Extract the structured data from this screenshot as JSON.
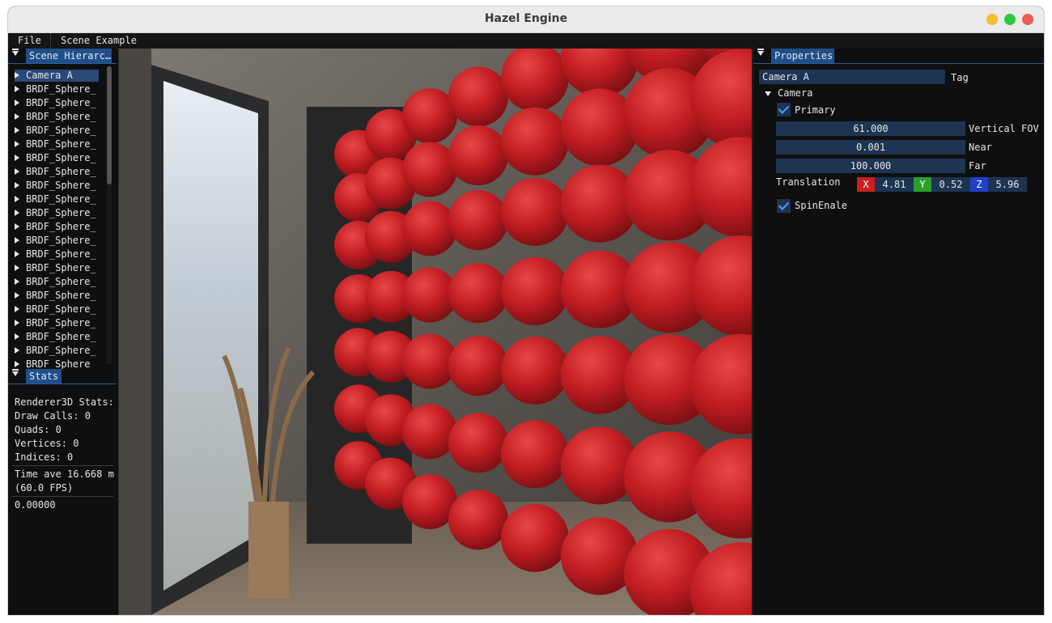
{
  "window": {
    "title": "Hazel Engine",
    "colors": {
      "minimize": "#f5bd2f",
      "maximize": "#2bc840",
      "close": "#ee5c55"
    }
  },
  "menu": {
    "items": [
      "File",
      "Scene Example"
    ]
  },
  "hierarchy": {
    "tab": "Scene Hierarc…",
    "items": [
      {
        "label": "Camera A",
        "selected": true
      },
      {
        "label": "BRDF_Sphere_"
      },
      {
        "label": "BRDF_Sphere_"
      },
      {
        "label": "BRDF_Sphere_"
      },
      {
        "label": "BRDF_Sphere_"
      },
      {
        "label": "BRDF_Sphere_"
      },
      {
        "label": "BRDF_Sphere_"
      },
      {
        "label": "BRDF_Sphere_"
      },
      {
        "label": "BRDF_Sphere_"
      },
      {
        "label": "BRDF_Sphere_"
      },
      {
        "label": "BRDF_Sphere_"
      },
      {
        "label": "BRDF_Sphere_"
      },
      {
        "label": "BRDF_Sphere_"
      },
      {
        "label": "BRDF_Sphere_"
      },
      {
        "label": "BRDF_Sphere_"
      },
      {
        "label": "BRDF_Sphere_"
      },
      {
        "label": "BRDF_Sphere_"
      },
      {
        "label": "BRDF_Sphere_"
      },
      {
        "label": "BRDF_Sphere_"
      },
      {
        "label": "BRDF_Sphere_"
      },
      {
        "label": "BRDF_Sphere_"
      },
      {
        "label": "BRDF_Sphere_"
      }
    ]
  },
  "stats": {
    "tab": "Stats",
    "heading": "Renderer3D Stats:",
    "draw_calls": "Draw Calls: 0",
    "quads": "Quads: 0",
    "vertices": "Vertices: 0",
    "indices": "Indices: 0",
    "time": "Time ave 16.668 m:",
    "fps": "(60.0 FPS)",
    "value": "0.00000"
  },
  "properties": {
    "tab": "Properties",
    "tag_value": "Camera A",
    "tag_label": "Tag",
    "camera_section": "Camera",
    "primary_label": "Primary",
    "fov_value": "61.000",
    "fov_label": "Vertical FOV",
    "near_value": "0.001",
    "near_label": "Near",
    "far_value": "100.000",
    "far_label": "Far",
    "translation_label": "Translation",
    "x_label": "X",
    "x_value": "4.81",
    "y_label": "Y",
    "y_value": "0.52",
    "z_label": "Z",
    "z_value": "5.96",
    "spin_label": "SpinEnale",
    "colors": {
      "x": "#cc2020",
      "y": "#2aa02a",
      "z": "#2040cc",
      "field": "#1d3452",
      "tab": "#1f4f8a"
    }
  },
  "viewport": {
    "sphere_color": "#c62020",
    "sphere_grid": {
      "columns": 8,
      "rows": 7
    }
  }
}
